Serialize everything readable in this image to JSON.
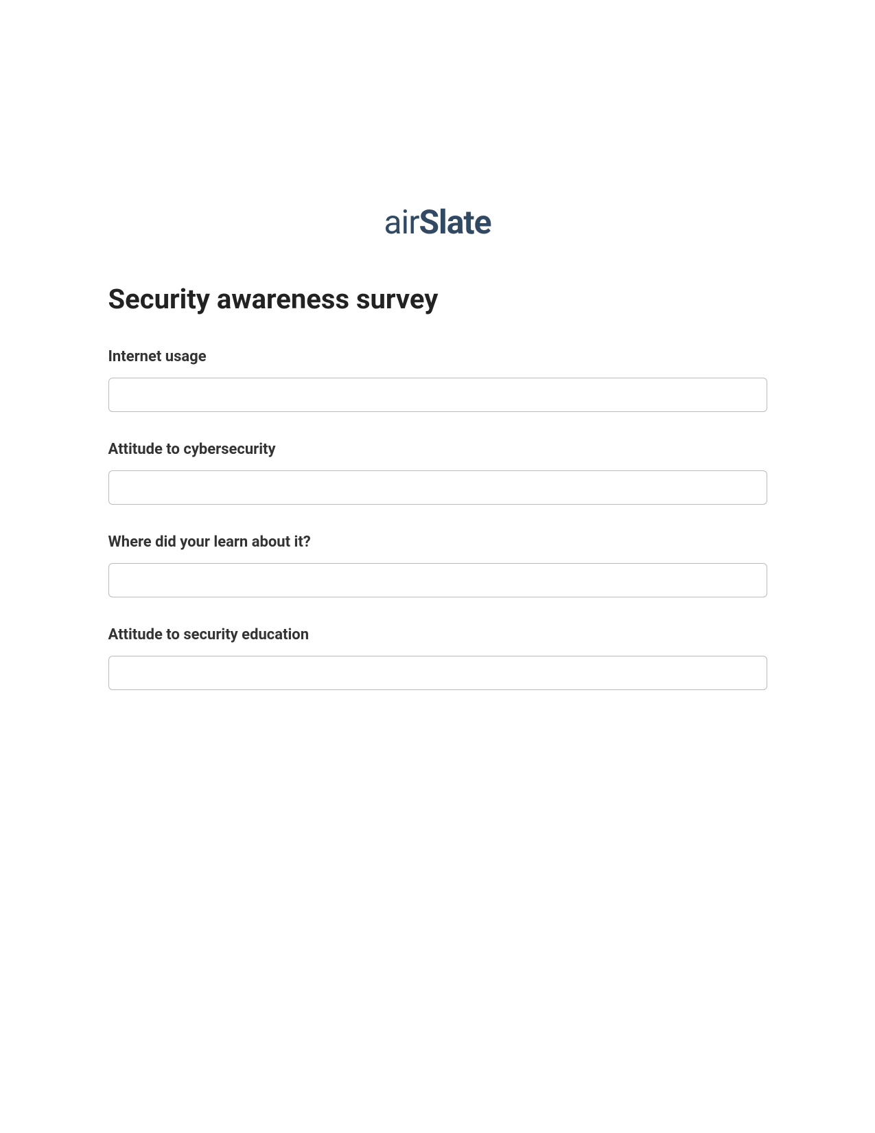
{
  "logo": {
    "prefix": "air",
    "suffix": "Slate"
  },
  "form": {
    "title": "Security awareness survey",
    "fields": [
      {
        "label": "Internet usage",
        "value": ""
      },
      {
        "label": "Attitude to cybersecurity",
        "value": ""
      },
      {
        "label": "Where did your learn about it?",
        "value": ""
      },
      {
        "label": "Attitude to security education",
        "value": ""
      }
    ]
  }
}
